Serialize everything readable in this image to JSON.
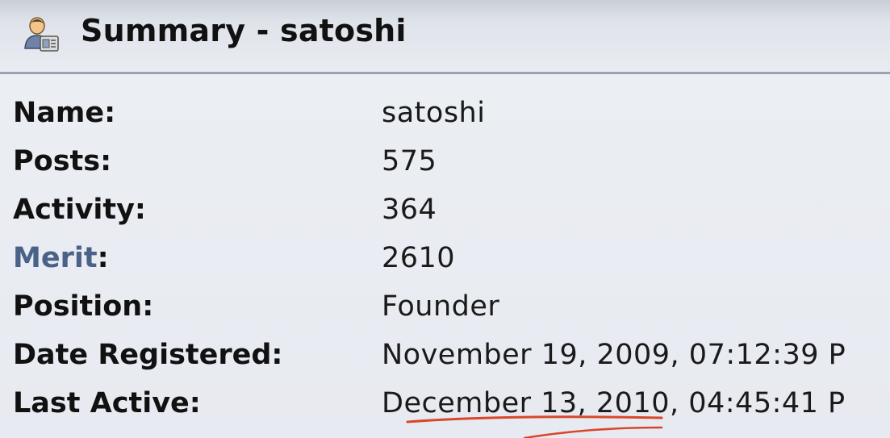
{
  "header": {
    "title": "Summary - satoshi",
    "icon": "user-profile-icon"
  },
  "profile": {
    "rows": [
      {
        "label": "Name",
        "suffix": ":",
        "value": "satoshi"
      },
      {
        "label": "Posts",
        "suffix": ":",
        "value": "575"
      },
      {
        "label": "Activity",
        "suffix": ":",
        "value": "364"
      },
      {
        "label": "Merit",
        "suffix": ":",
        "value": "2610"
      },
      {
        "label": "Position",
        "suffix": ":",
        "value": "Founder"
      },
      {
        "label": "Date Registered",
        "suffix": ":",
        "value": "November 19, 2009, 07:12:39 P"
      },
      {
        "label": "Last Active",
        "suffix": ":",
        "value": "December 13, 2010, 04:45:41 P"
      }
    ]
  },
  "colors": {
    "merit_link": "#4b6288",
    "header_border": "#9aa3b1",
    "annotation_underline": "#d9472b"
  }
}
